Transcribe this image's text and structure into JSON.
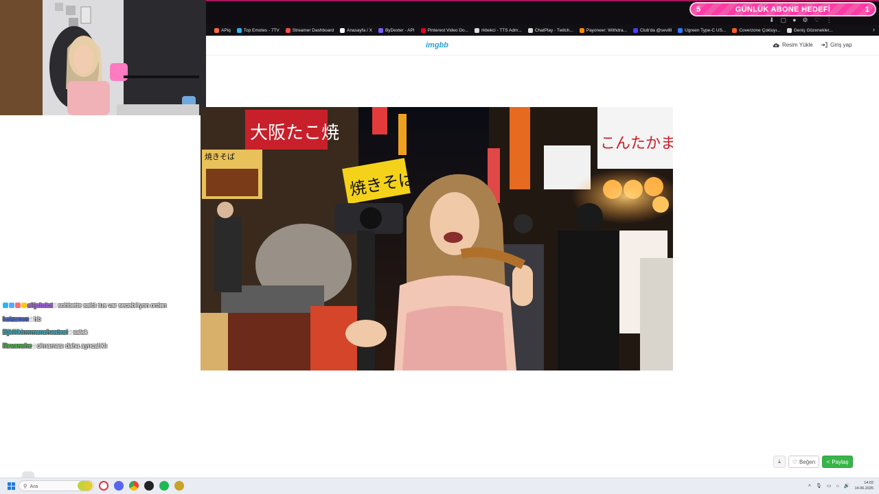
{
  "sub_goal": {
    "left_count": "5",
    "title": "GÜNLÜK ABONE HEDEFİ",
    "right_count": "1"
  },
  "bookmarks": [
    {
      "label": "APiq",
      "icon": "app-icon",
      "color": "#ff6b3d"
    },
    {
      "label": "Top Emotes - 7TV",
      "icon": "7tv-icon",
      "color": "#29b6f6"
    },
    {
      "label": "Streamer Dashboard",
      "icon": "streamer-icon",
      "color": "#ff4d4d"
    },
    {
      "label": "Anasayfa / X",
      "icon": "x-icon",
      "color": "#ffffff"
    },
    {
      "label": "ByDexter - API",
      "icon": "api-icon",
      "color": "#7c5cff"
    },
    {
      "label": "Pinterest Video Do...",
      "icon": "pinterest-icon",
      "color": "#e60023"
    },
    {
      "label": "rkbekci - TTS Adm...",
      "icon": "page-icon",
      "color": "#dddddd"
    },
    {
      "label": "ChatPlay - Twitch...",
      "icon": "chatplay-icon",
      "color": "#dddddd"
    },
    {
      "label": "Payoneer: Withdra...",
      "icon": "payoneer-icon",
      "color": "#ff8a00"
    },
    {
      "label": "Club'da @sevilll",
      "icon": "club-icon",
      "color": "#4b3df5"
    },
    {
      "label": "Ugreen Type-C US...",
      "icon": "ugreen-icon",
      "color": "#2f7bff"
    },
    {
      "label": "Coverzone Çokluyı...",
      "icon": "coverzone-icon",
      "color": "#ff5a1f"
    },
    {
      "label": "Geniş Gözenekler...",
      "icon": "page-icon",
      "color": "#dddddd"
    }
  ],
  "site": {
    "logo": "imgbb",
    "upload_label": "Resim Yükle",
    "login_label": "Giriş yap"
  },
  "chat": [
    {
      "user": "elijahdot",
      "user_color": "#b05cff",
      "message": ": sohbette saldı tus var secebiliyon ordan",
      "badges": [
        "#29b6f6",
        "#5aa7ff",
        "#ff6b6b",
        "#ffcc00"
      ]
    },
    {
      "user": "kaizenxn",
      "user_color": "#3b5bdb",
      "message": ": hb",
      "badges": []
    },
    {
      "user": "Bjkliikirmmenehastasi",
      "user_color": "#1ab7c4",
      "message": ": salak",
      "badges": []
    },
    {
      "user": "Revanche",
      "user_color": "#35c935",
      "message": ": olmaması daha ayrıcalıklı",
      "badges": []
    }
  ],
  "actions": {
    "like_label": "Beğen",
    "share_label": "Paylaş"
  },
  "taskbar": {
    "search_placeholder": "Ara",
    "time": "14:02",
    "date": "14.06.2026"
  },
  "photo_signs": {
    "sign1": "こんたかま屋",
    "sign2": "焼きそば",
    "sign3": "大阪たこ焼"
  }
}
